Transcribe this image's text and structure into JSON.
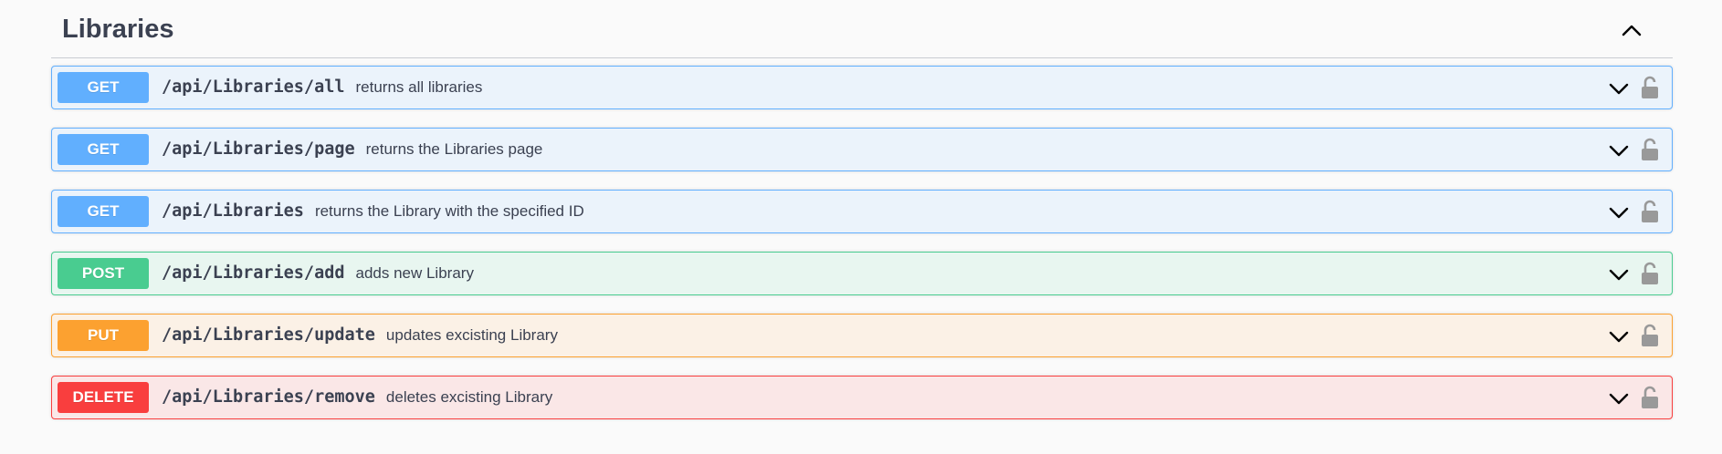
{
  "section": {
    "title": "Libraries",
    "collapse_icon": "chevron-up-icon"
  },
  "operations": [
    {
      "method": "GET",
      "path": "/api/Libraries/all",
      "summary": "returns all libraries",
      "color": "#61affe"
    },
    {
      "method": "GET",
      "path": "/api/Libraries/page",
      "summary": "returns the Libraries page",
      "color": "#61affe"
    },
    {
      "method": "GET",
      "path": "/api/Libraries",
      "summary": "returns the Library with the specified ID",
      "color": "#61affe"
    },
    {
      "method": "POST",
      "path": "/api/Libraries/add",
      "summary": "adds new Library",
      "color": "#49cc90"
    },
    {
      "method": "PUT",
      "path": "/api/Libraries/update",
      "summary": "updates excisting Library",
      "color": "#fca130"
    },
    {
      "method": "DELETE",
      "path": "/api/Libraries/remove",
      "summary": "deletes excisting Library",
      "color": "#f93e3e"
    }
  ],
  "row_icons": {
    "expand": "chevron-down-icon",
    "auth": "unlocked-icon"
  }
}
